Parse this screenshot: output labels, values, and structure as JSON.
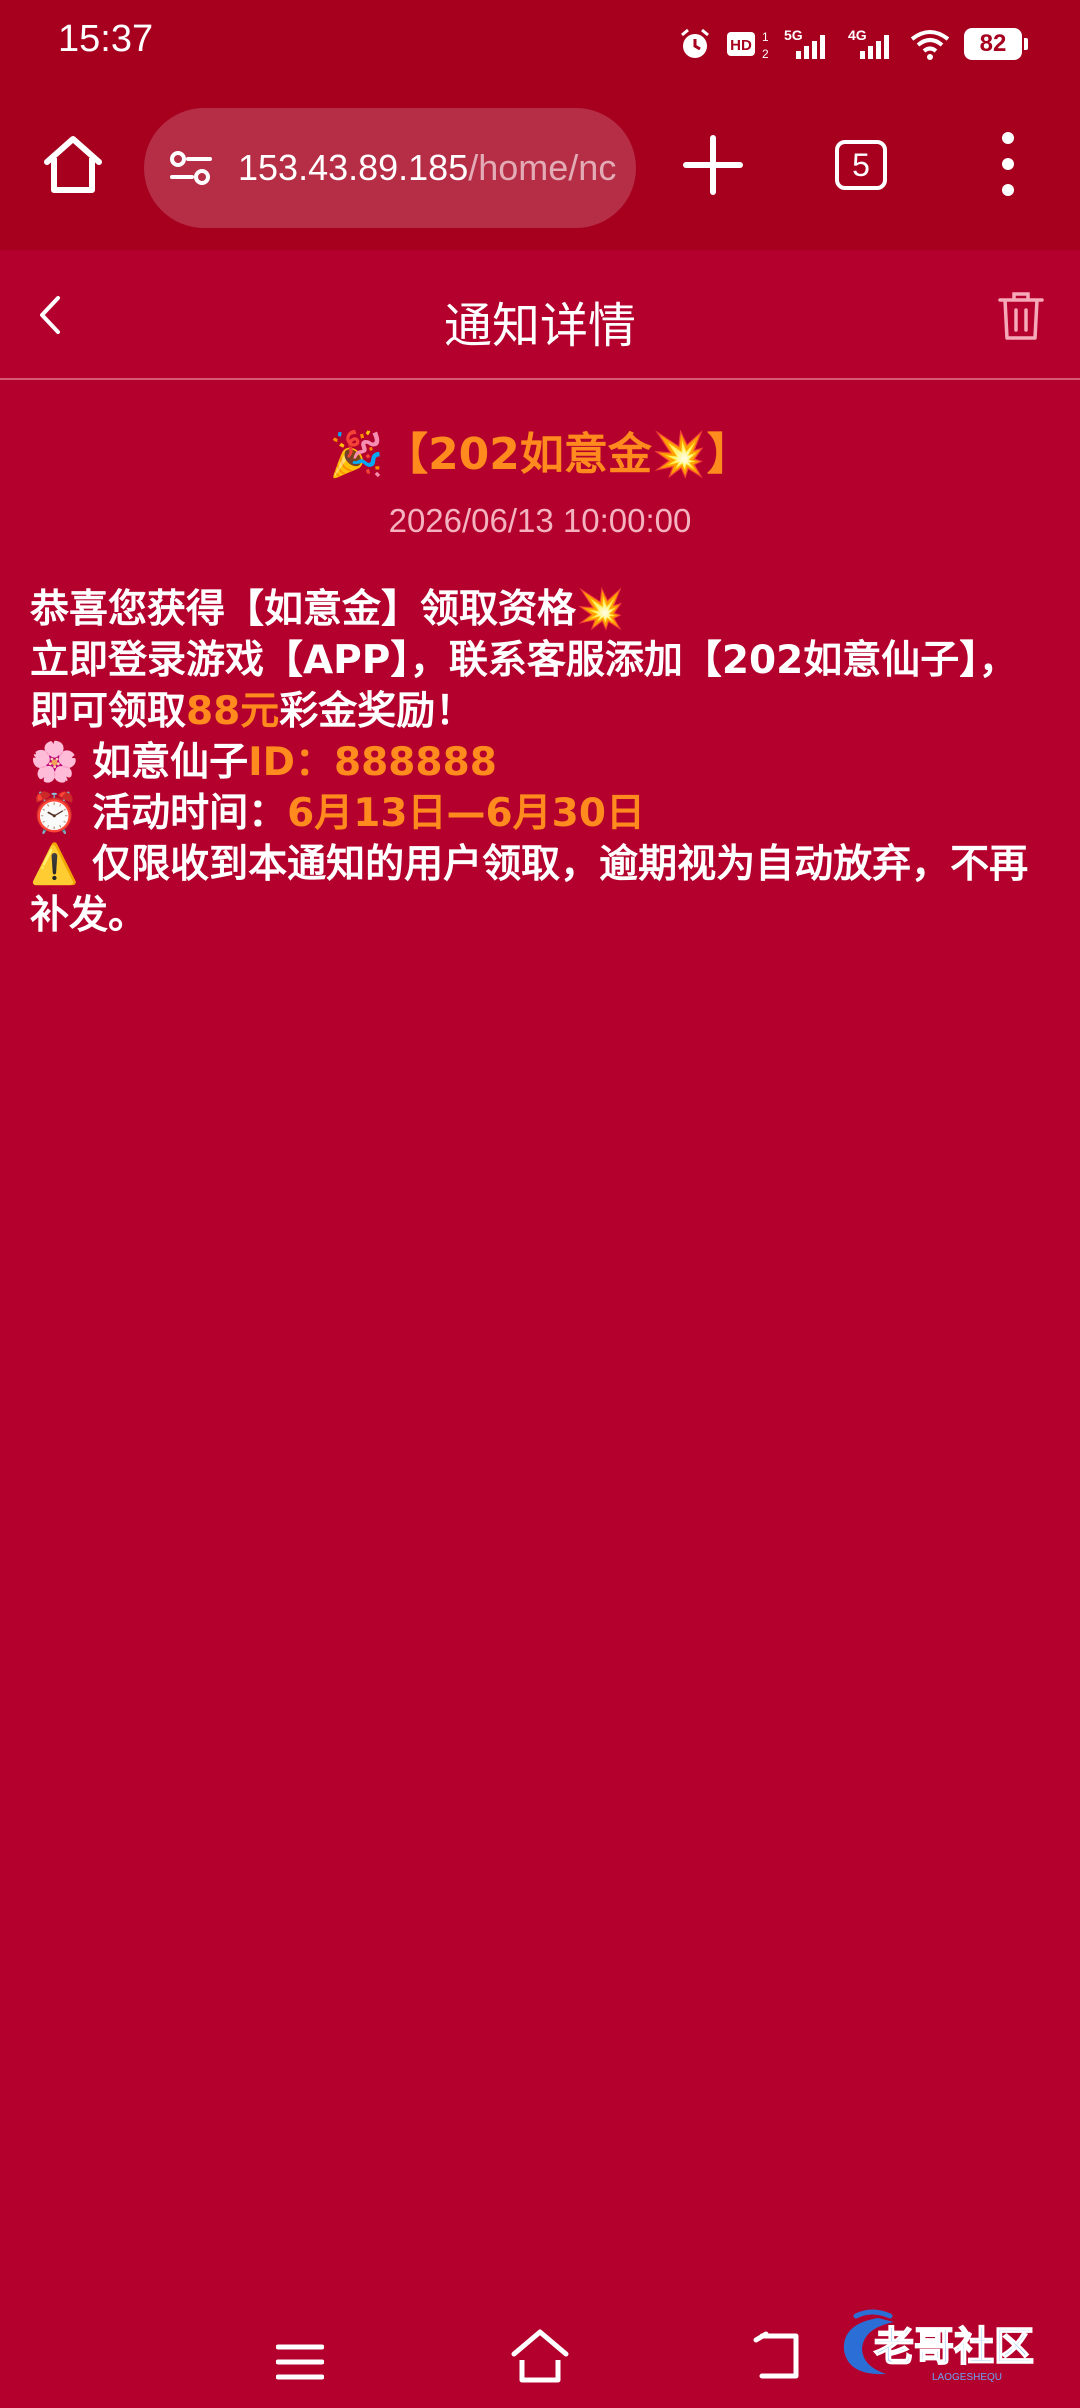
{
  "status_bar": {
    "time": "15:37",
    "battery": "82",
    "icons": [
      "alarm-icon",
      "hd-icon",
      "5g-signal-icon",
      "4g-signal-icon",
      "wifi-icon",
      "battery-icon"
    ]
  },
  "browser": {
    "url_main": "153.43.89.185",
    "url_path": "/home/nc",
    "tab_count": "5",
    "icons": [
      "home-icon",
      "site-settings-icon",
      "plus-icon",
      "more-vertical-icon"
    ]
  },
  "header": {
    "title": "通知详情",
    "icons": [
      "back-chevron-icon",
      "trash-icon"
    ]
  },
  "notice": {
    "title_prefix": "🎉【202如意金",
    "title_suffix": "💥】",
    "date": "2026/06/13 10:00:00",
    "line1": "恭喜您获得【如意金】领取资格💥",
    "line2_a": "立即登录游戏【APP】，联系客服添加【202如意仙子】，即可领取",
    "line2_amount": "88元",
    "line2_b": "彩金奖励！",
    "line3_a": "🌸 如意仙子",
    "line3_id": "ID：888888",
    "line4_a": "⏰ 活动时间：",
    "line4_time": "6月13日—6月30日",
    "line5": "⚠️ 仅限收到本通知的用户领取，逾期视为自动放弃，不再补发。"
  },
  "nav": {
    "icons": [
      "menu-lines-icon",
      "home-outline-icon",
      "back-arrow-icon"
    ]
  },
  "watermark": {
    "text": "老哥社区",
    "subtext": "LAOGESHEQU"
  },
  "colors": {
    "background": "#b4002c",
    "bar": "#a6001e",
    "highlight": "#ff8a1d"
  }
}
